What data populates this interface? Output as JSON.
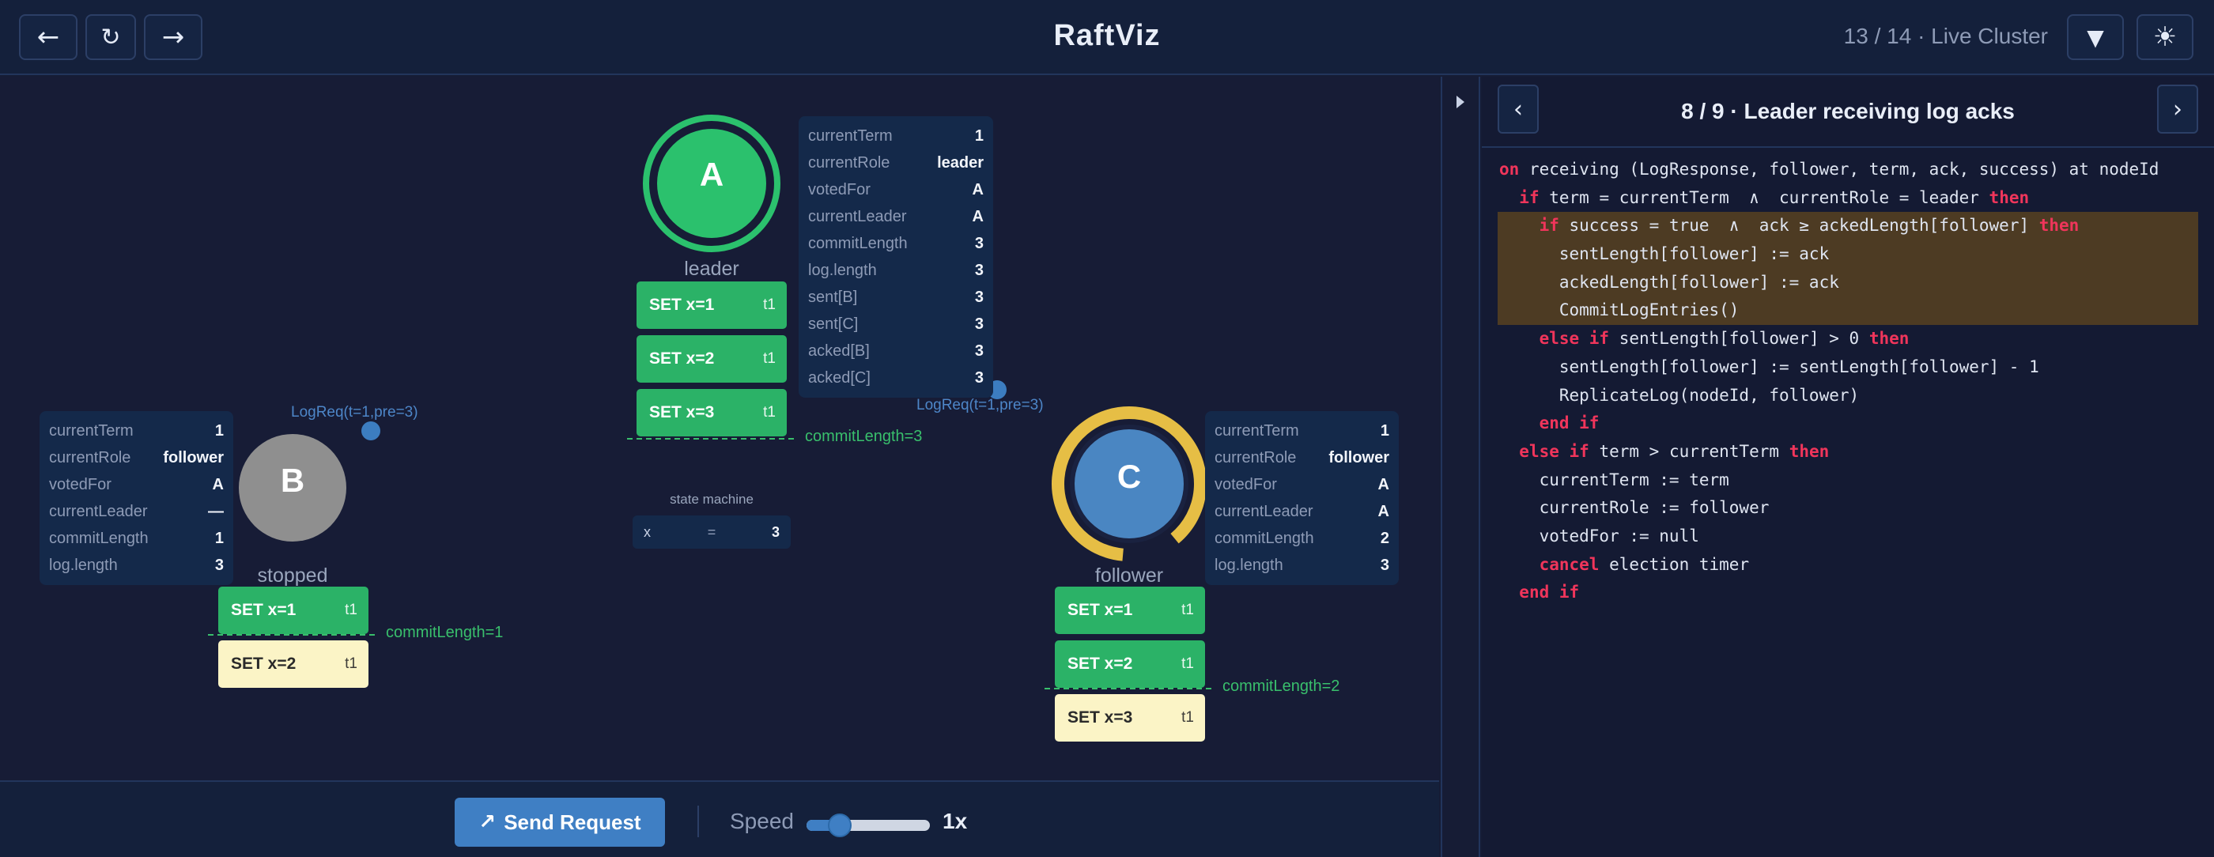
{
  "app": {
    "title": "RaftViz",
    "step_label": "13 / 14 · Live Cluster",
    "nav": {
      "back": "←",
      "reload": "↻",
      "forward": "→"
    },
    "filter_icon": "▼",
    "theme_icon": "☀"
  },
  "nodes": {
    "A": {
      "letter": "A",
      "role_label": "leader",
      "color": "#2bc16d",
      "info": [
        {
          "key": "currentTerm",
          "val": "1"
        },
        {
          "key": "currentRole",
          "val": "leader"
        },
        {
          "key": "votedFor",
          "val": "A"
        },
        {
          "key": "currentLeader",
          "val": "A"
        },
        {
          "key": "commitLength",
          "val": "3"
        },
        {
          "key": "log.length",
          "val": "3"
        },
        {
          "key": "sent[B]",
          "val": "3"
        },
        {
          "key": "sent[C]",
          "val": "3"
        },
        {
          "key": "acked[B]",
          "val": "3"
        },
        {
          "key": "acked[C]",
          "val": "3"
        }
      ],
      "log": [
        {
          "cmd": "SET x=1",
          "term": "t1"
        },
        {
          "cmd": "SET x=2",
          "term": "t1"
        },
        {
          "cmd": "SET x=3",
          "term": "t1"
        }
      ],
      "commit_label": "commitLength=3"
    },
    "B": {
      "letter": "B",
      "role_label": "stopped",
      "color": "#8f8f8f",
      "info": [
        {
          "key": "currentTerm",
          "val": "1"
        },
        {
          "key": "currentRole",
          "val": "follower"
        },
        {
          "key": "votedFor",
          "val": "A"
        },
        {
          "key": "currentLeader",
          "val": "—"
        },
        {
          "key": "commitLength",
          "val": "1"
        },
        {
          "key": "log.length",
          "val": "3"
        }
      ],
      "log": [
        {
          "cmd": "SET x=1",
          "term": "t1"
        },
        {
          "cmd": "SET x=2",
          "term": "t1"
        }
      ],
      "commit_label": "commitLength=1"
    },
    "C": {
      "letter": "C",
      "role_label": "follower",
      "color": "#4a86c2",
      "ring_color": "#e6be45",
      "info": [
        {
          "key": "currentTerm",
          "val": "1"
        },
        {
          "key": "currentRole",
          "val": "follower"
        },
        {
          "key": "votedFor",
          "val": "A"
        },
        {
          "key": "currentLeader",
          "val": "A"
        },
        {
          "key": "commitLength",
          "val": "2"
        },
        {
          "key": "log.length",
          "val": "3"
        }
      ],
      "log": [
        {
          "cmd": "SET x=1",
          "term": "t1"
        },
        {
          "cmd": "SET x=2",
          "term": "t1"
        },
        {
          "cmd": "SET x=3",
          "term": "t1"
        }
      ],
      "commit_label": "commitLength=2"
    }
  },
  "messages": {
    "to_B": "LogReq(t=1,pre=3)",
    "to_C": "LogReq(t=1,pre=3)"
  },
  "state_machine": {
    "title": "state machine",
    "key": "x",
    "eq": "=",
    "value": "3"
  },
  "controls": {
    "send_label": "Send Request",
    "send_icon": "↗",
    "speed_label": "Speed",
    "speed_value": "1x",
    "speed_level": 0.27
  },
  "code_panel": {
    "prev": "‹",
    "next": "›",
    "step_title": "8 / 9 · Leader receiving log acks",
    "lines": [
      [
        {
          "t": "on",
          "k": 1
        },
        {
          "t": " receiving (LogResponse, follower, term, ack, success) at nodeId"
        }
      ],
      [
        {
          "t": "  "
        },
        {
          "t": "if",
          "k": 1
        },
        {
          "t": " term = currentTerm  ∧  currentRole = leader "
        },
        {
          "t": "then",
          "k": 1
        }
      ],
      [
        {
          "t": "    "
        },
        {
          "t": "if",
          "k": 1
        },
        {
          "t": " success = true  ∧  ack ≥ ackedLength[follower] "
        },
        {
          "t": "then",
          "k": 1
        }
      ],
      [
        {
          "t": "      sentLength[follower] := ack"
        }
      ],
      [
        {
          "t": "      ackedLength[follower] := ack"
        }
      ],
      [
        {
          "t": "      CommitLogEntries()"
        }
      ],
      [
        {
          "t": "    "
        },
        {
          "t": "else if",
          "k": 1
        },
        {
          "t": " sentLength[follower] > 0 "
        },
        {
          "t": "then",
          "k": 1
        }
      ],
      [
        {
          "t": "      sentLength[follower] := sentLength[follower] - 1"
        }
      ],
      [
        {
          "t": "      ReplicateLog(nodeId, follower)"
        }
      ],
      [
        {
          "t": "    "
        },
        {
          "t": "end if",
          "k": 1
        }
      ],
      [
        {
          "t": "  "
        },
        {
          "t": "else if",
          "k": 1
        },
        {
          "t": " term > currentTerm "
        },
        {
          "t": "then",
          "k": 1
        }
      ],
      [
        {
          "t": "    currentTerm := term"
        }
      ],
      [
        {
          "t": "    currentRole := follower"
        }
      ],
      [
        {
          "t": "    votedFor := null"
        }
      ],
      [
        {
          "t": "    "
        },
        {
          "t": "cancel",
          "k": 1
        },
        {
          "t": " election timer"
        }
      ],
      [
        {
          "t": "  "
        },
        {
          "t": "end if",
          "k": 1
        }
      ]
    ],
    "highlight_lines": [
      2,
      3,
      4,
      5
    ],
    "highlight_color": "#4d3b23",
    "keyword_color": "#f0355b"
  }
}
